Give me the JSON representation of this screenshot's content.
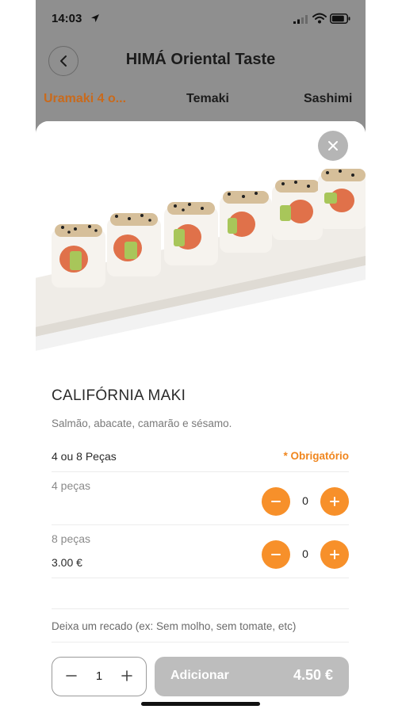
{
  "status_bar": {
    "time": "14:03"
  },
  "header": {
    "title": "HIMÁ Oriental Taste"
  },
  "tabs": [
    {
      "label": "Uramaki 4 o..."
    },
    {
      "label": "Temaki"
    },
    {
      "label": "Sashimi"
    }
  ],
  "product": {
    "name": "CALIFÓRNIA MAKI",
    "description": "Salmão, abacate, camarão e sésamo.",
    "image": "california-maki-photo"
  },
  "option_group": {
    "title": "4 ou 8 Peças",
    "required_label": "* Obrigatório",
    "options": [
      {
        "label": "4 peças",
        "price": "",
        "count": "0"
      },
      {
        "label": "8 peças",
        "price": "3.00 €",
        "count": "0"
      }
    ]
  },
  "note": {
    "placeholder": "Deixa um recado (ex: Sem molho, sem tomate, etc)"
  },
  "footer": {
    "quantity": "1",
    "add_label": "Adicionar",
    "total": "4.50 €"
  },
  "colors": {
    "accent": "#f7902a",
    "active_tab": "#c96a1c",
    "add_button_disabled": "#bdbdbd",
    "overlay": "#8f8f8f"
  },
  "icons": [
    "location-arrow-icon",
    "cellular-signal-icon",
    "wifi-icon",
    "battery-icon",
    "back-chevron-icon",
    "close-icon",
    "minus-icon",
    "plus-icon"
  ]
}
